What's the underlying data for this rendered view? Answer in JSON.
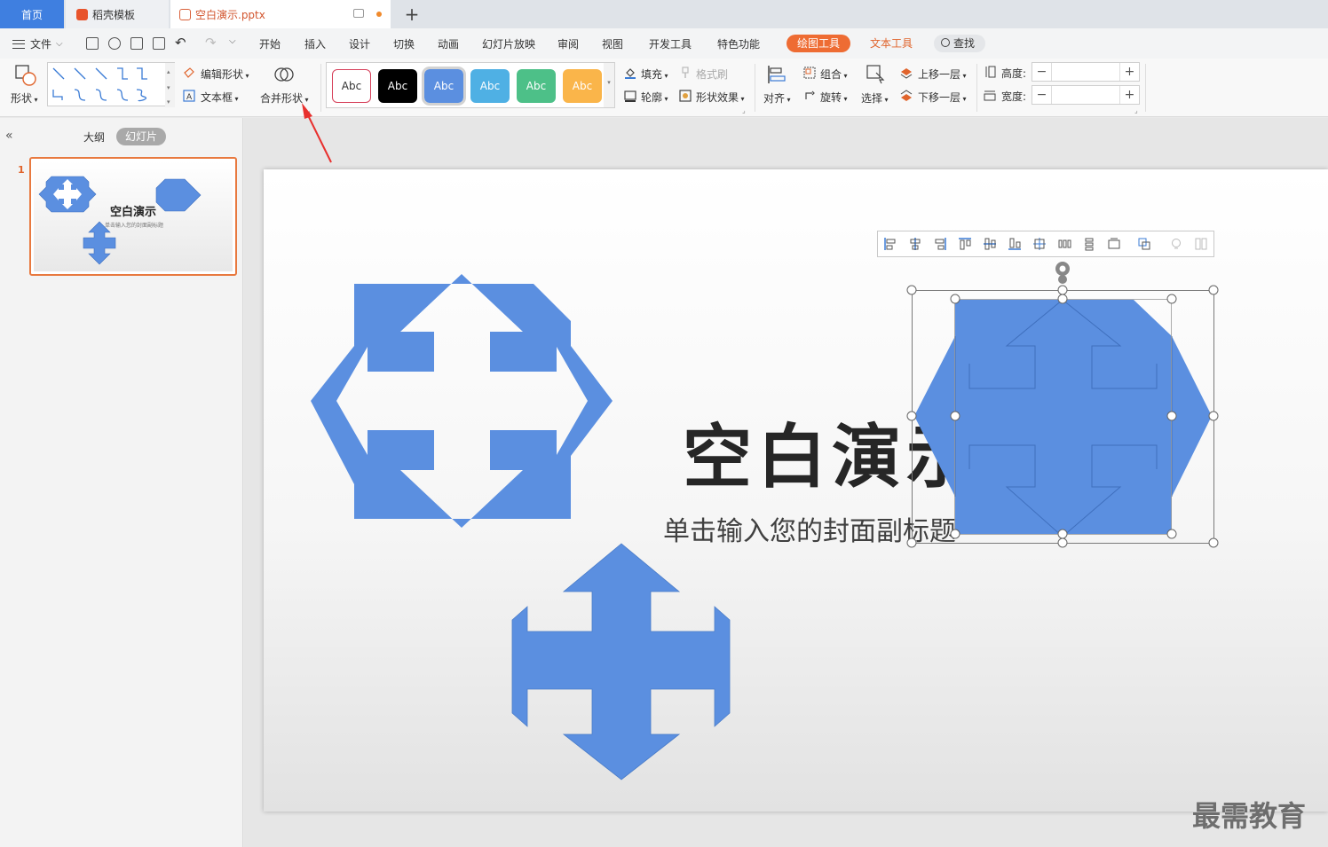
{
  "tabs": {
    "home": "首页",
    "template": "稻壳模板",
    "document": "空白演示.pptx"
  },
  "menu": {
    "file": "文件",
    "items": [
      "开始",
      "插入",
      "设计",
      "切换",
      "动画",
      "幻灯片放映",
      "审阅",
      "视图",
      "开发工具",
      "特色功能"
    ],
    "drawing_tools": "绘图工具",
    "text_tools": "文本工具",
    "find": "查找"
  },
  "ribbon": {
    "shape": "形状",
    "edit_shape": "编辑形状",
    "textbox": "文本框",
    "merge_shapes": "合并形状",
    "style_samples": [
      "Abc",
      "Abc",
      "Abc",
      "Abc",
      "Abc",
      "Abc"
    ],
    "fill": "填充",
    "format_painter": "格式刷",
    "outline": "轮廓",
    "shape_effects": "形状效果",
    "align": "对齐",
    "group": "组合",
    "rotate": "旋转",
    "select": "选择",
    "bring_forward": "上移一层",
    "send_backward": "下移一层",
    "height_label": "高度:",
    "width_label": "宽度:",
    "height_value": "",
    "width_value": ""
  },
  "panel": {
    "outline_tab": "大纲",
    "slides_tab": "幻灯片",
    "slide_number": "1",
    "thumb_title": "空白演示",
    "thumb_subtitle": "单击输入您的封面副标题"
  },
  "slide": {
    "title": "空白演示",
    "subtitle": "单击输入您的封面副标题"
  },
  "watermark": "最需教育",
  "colors": {
    "shape_fill": "#5b8fe0",
    "accent_orange": "#ee6c33",
    "tab_blue": "#3f7fe0"
  }
}
